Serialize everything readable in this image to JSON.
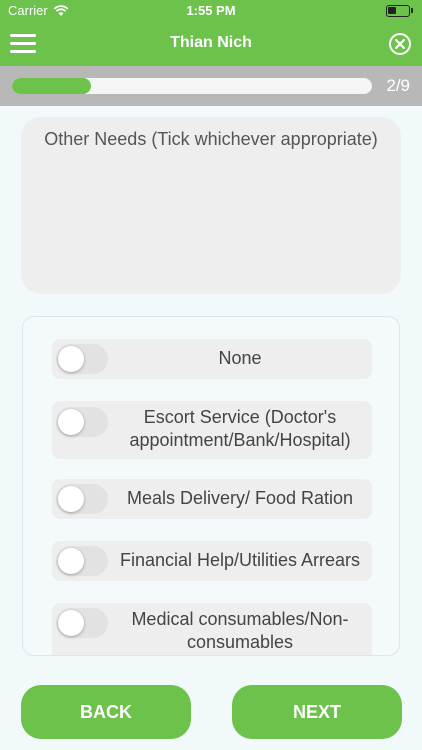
{
  "status_bar": {
    "carrier": "Carrier",
    "time": "1:55 PM"
  },
  "nav": {
    "title": "Thian Nich",
    "menu_icon": "hamburger-icon",
    "close_icon": "close-circle-icon"
  },
  "progress": {
    "current": 2,
    "total": 9,
    "label": "2/9",
    "fraction": 0.22
  },
  "question": {
    "text": "Other Needs (Tick whichever appropriate)"
  },
  "options": [
    {
      "label": "None",
      "checked": false
    },
    {
      "label": "Escort Service (Doctor's appointment/Bank/Hospital)",
      "checked": false
    },
    {
      "label": "Meals Delivery/ Food Ration",
      "checked": false
    },
    {
      "label": "Financial Help/Utilities Arrears",
      "checked": false
    },
    {
      "label": "Medical consumables/Non-consumables",
      "checked": false
    }
  ],
  "buttons": {
    "back": "BACK",
    "next": "NEXT"
  },
  "colors": {
    "primary": "#6cc24a",
    "progress_bg": "#b8b8b8",
    "card": "#eeeeee"
  }
}
